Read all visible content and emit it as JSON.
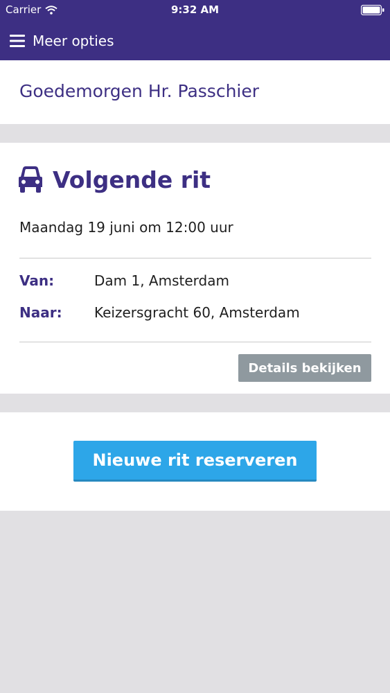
{
  "status_bar": {
    "carrier": "Carrier",
    "time": "9:32 AM",
    "icons": [
      "wifi-icon",
      "battery-icon"
    ]
  },
  "nav": {
    "menu_label": "Meer opties",
    "menu_icon": "hamburger-menu-icon",
    "background_color": "#3d2f83"
  },
  "greeting": {
    "text": "Goedemorgen Hr. Passchier"
  },
  "next_ride": {
    "icon": "car-icon",
    "title": "Volgende rit",
    "datetime": "Maandag 19 juni om 12:00 uur",
    "from_label": "Van:",
    "from_value": "Dam 1, Amsterdam",
    "to_label": "Naar:",
    "to_value": "Keizersgracht 60, Amsterdam",
    "details_button": "Details bekijken"
  },
  "new_ride": {
    "button": "Nieuwe rit reserveren"
  },
  "colors": {
    "accent": "#3d2f83",
    "primary_button": "#2da6e8",
    "secondary_button": "#8f999f",
    "background": "#e1e0e3"
  }
}
